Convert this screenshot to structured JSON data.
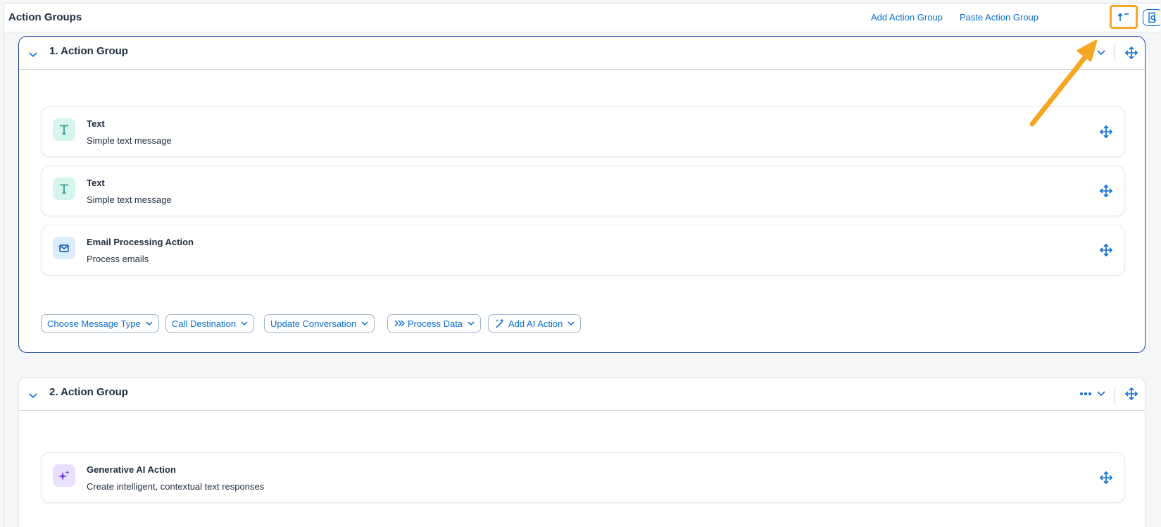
{
  "header": {
    "title": "Action Groups",
    "add_action_group": "Add Action Group",
    "paste_action_group": "Paste Action Group"
  },
  "groups": [
    {
      "title": "1. Action Group",
      "actions": [
        {
          "title": "Text",
          "subtitle": "Simple text message",
          "icon": "text-icon"
        },
        {
          "title": "Text",
          "subtitle": "Simple text message",
          "icon": "text-icon"
        },
        {
          "title": "Email Processing Action",
          "subtitle": "Process emails",
          "icon": "email-icon"
        }
      ],
      "buttons": [
        {
          "label": "Choose Message Type"
        },
        {
          "label": "Call Destination"
        },
        {
          "label": "Update Conversation"
        },
        {
          "label": "Process Data",
          "icon": "process-data-icon"
        },
        {
          "label": "Add AI Action",
          "icon": "ai-magic-icon"
        }
      ]
    },
    {
      "title": "2. Action Group",
      "actions": [
        {
          "title": "Generative AI Action",
          "subtitle": "Create intelligent, contextual text responses",
          "icon": "sparkle-icon"
        }
      ]
    }
  ],
  "colors": {
    "accent": "#0a6ed1",
    "selected_border": "#1a3fa1",
    "highlight": "#f5a623",
    "text_icon_bg": "#d5f5ee",
    "email_icon_bg": "#dcecff",
    "ai_icon_bg": "#e9e0ff"
  }
}
